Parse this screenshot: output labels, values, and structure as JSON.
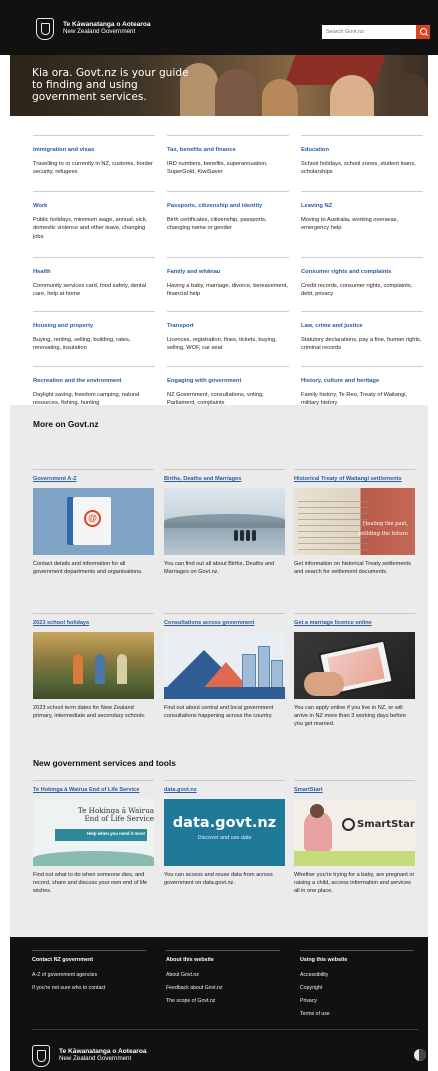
{
  "header": {
    "logo_line1": "Te Kāwanatanga o Aotearoa",
    "logo_line2": "New Zealand Government",
    "search_placeholder": "Search Govt.nz"
  },
  "hero": {
    "title": "Kia ora. Govt.nz is your guide to finding and using government services."
  },
  "topics": [
    {
      "title": "Immigration and visas",
      "desc": "Travelling to or currently in NZ, customs, border security, refugees"
    },
    {
      "title": "Tax, benefits and finance",
      "desc": "IRD numbers, benefits, superannuation, SuperGold, KiwiSaver"
    },
    {
      "title": "Education",
      "desc": "School holidays, school zones, student loans, scholarships"
    },
    {
      "title": "Work",
      "desc": "Public holidays, minimum wage, annual, sick, domestic violence and other leave, changing jobs"
    },
    {
      "title": "Passports, citizenship and identity",
      "desc": "Birth certificates, citizenship, passports, changing name or gender"
    },
    {
      "title": "Leaving NZ",
      "desc": "Moving to Australia, working overseas, emergency help"
    },
    {
      "title": "Health",
      "desc": "Community services card, food safety, dental care, help at home"
    },
    {
      "title": "Family and whānau",
      "desc": "Having a baby, marriage, divorce, bereavement, financial help"
    },
    {
      "title": "Consumer rights and complaints",
      "desc": "Credit records, consumer rights, complaints, debt, privacy"
    },
    {
      "title": "Housing and property",
      "desc": "Buying, renting, selling, building, rates, renovating, insulation"
    },
    {
      "title": "Transport",
      "desc": "Licences, registration, fines, tickets, buying, selling, WOF, car seat"
    },
    {
      "title": "Law, crime and justice",
      "desc": "Statutory declarations, pay a fine, human rights, criminal records"
    },
    {
      "title": "Recreation and the environment",
      "desc": "Daylight saving, freedom camping, natural resources, fishing, hunting"
    },
    {
      "title": "Engaging with government",
      "desc": "NZ Government, consultations, voting, Parliament, complaints"
    },
    {
      "title": "History, culture and heritage",
      "desc": "Family history, Te Reo, Treaty of Waitangi, military history"
    }
  ],
  "more": {
    "heading": "More on Govt.nz",
    "cards": [
      {
        "title": "Government A-Z",
        "desc": "Contact details and information for all government departments and organisations.",
        "image": "book-at-icon"
      },
      {
        "title": "Births, Deaths and Marriages",
        "desc": "You can find out all about Births, Deaths and Marriages on Govt.nz.",
        "image": "beach-people-photo"
      },
      {
        "title": "Historical Treaty of Waitangi settlements",
        "desc": "Get information on historical Treaty settlements and search for settlement documents.",
        "image": "treaty-document-photo",
        "overlay1": "Healing the past,",
        "overlay2": "building the future"
      },
      {
        "title": "2023 school holidays",
        "desc": "2023 school term dates for New Zealand primary, intermediate and secondary schools.",
        "image": "children-river-photo"
      },
      {
        "title": "Consultations across government",
        "desc": "Find out about central and local government consultations happening across the country.",
        "image": "mountains-city-illustration"
      },
      {
        "title": "Get a marriage licence online",
        "desc": "You can apply online if you live in NZ, or will arrive in NZ more than 3 working days before you get married.",
        "image": "tablet-hands-photo"
      }
    ]
  },
  "services": {
    "heading": "New government services and tools",
    "cards": [
      {
        "title": "Te Hokinga ā Wairua End of Life Service",
        "desc": "Find out what to do when someone dies, and record, share and discuss your own end of life wishes.",
        "image_text1": "Te Hokinga ā Wairua",
        "image_text2": "End of Life Service",
        "image_text3": "Help when you need it most"
      },
      {
        "title": "data.govt.nz",
        "desc": "You can access and reuse data from across government on data.govt.nz.",
        "image_text1": "data.govt.nz",
        "image_text2": "Discover and use data"
      },
      {
        "title": "SmartStart",
        "desc": "Whether you're trying for a baby, are pregnant or raising a child, access information and services all in one place.",
        "image_text1": "SmartStart"
      }
    ]
  },
  "footer": {
    "col1": {
      "heading": "Contact NZ government",
      "links": [
        "A-Z of government agencies",
        "If you're not sure who to contact"
      ]
    },
    "col2": {
      "heading": "About this website",
      "links": [
        "About Govt.nz",
        "Feedback about Govt.nz",
        "The scope of Govt.nz"
      ]
    },
    "col3": {
      "heading": "Using this website",
      "links": [
        "Accessibility",
        "Copyright",
        "Privacy",
        "Terms of use"
      ]
    },
    "logo_line1": "Te Kāwanatanga o Aotearoa",
    "logo_line2": "New Zealand Government"
  },
  "colors": {
    "header_bg": "#111111",
    "link": "#2a5d9f",
    "search_button": "#e0431a",
    "section_bg": "#ebebeb"
  }
}
